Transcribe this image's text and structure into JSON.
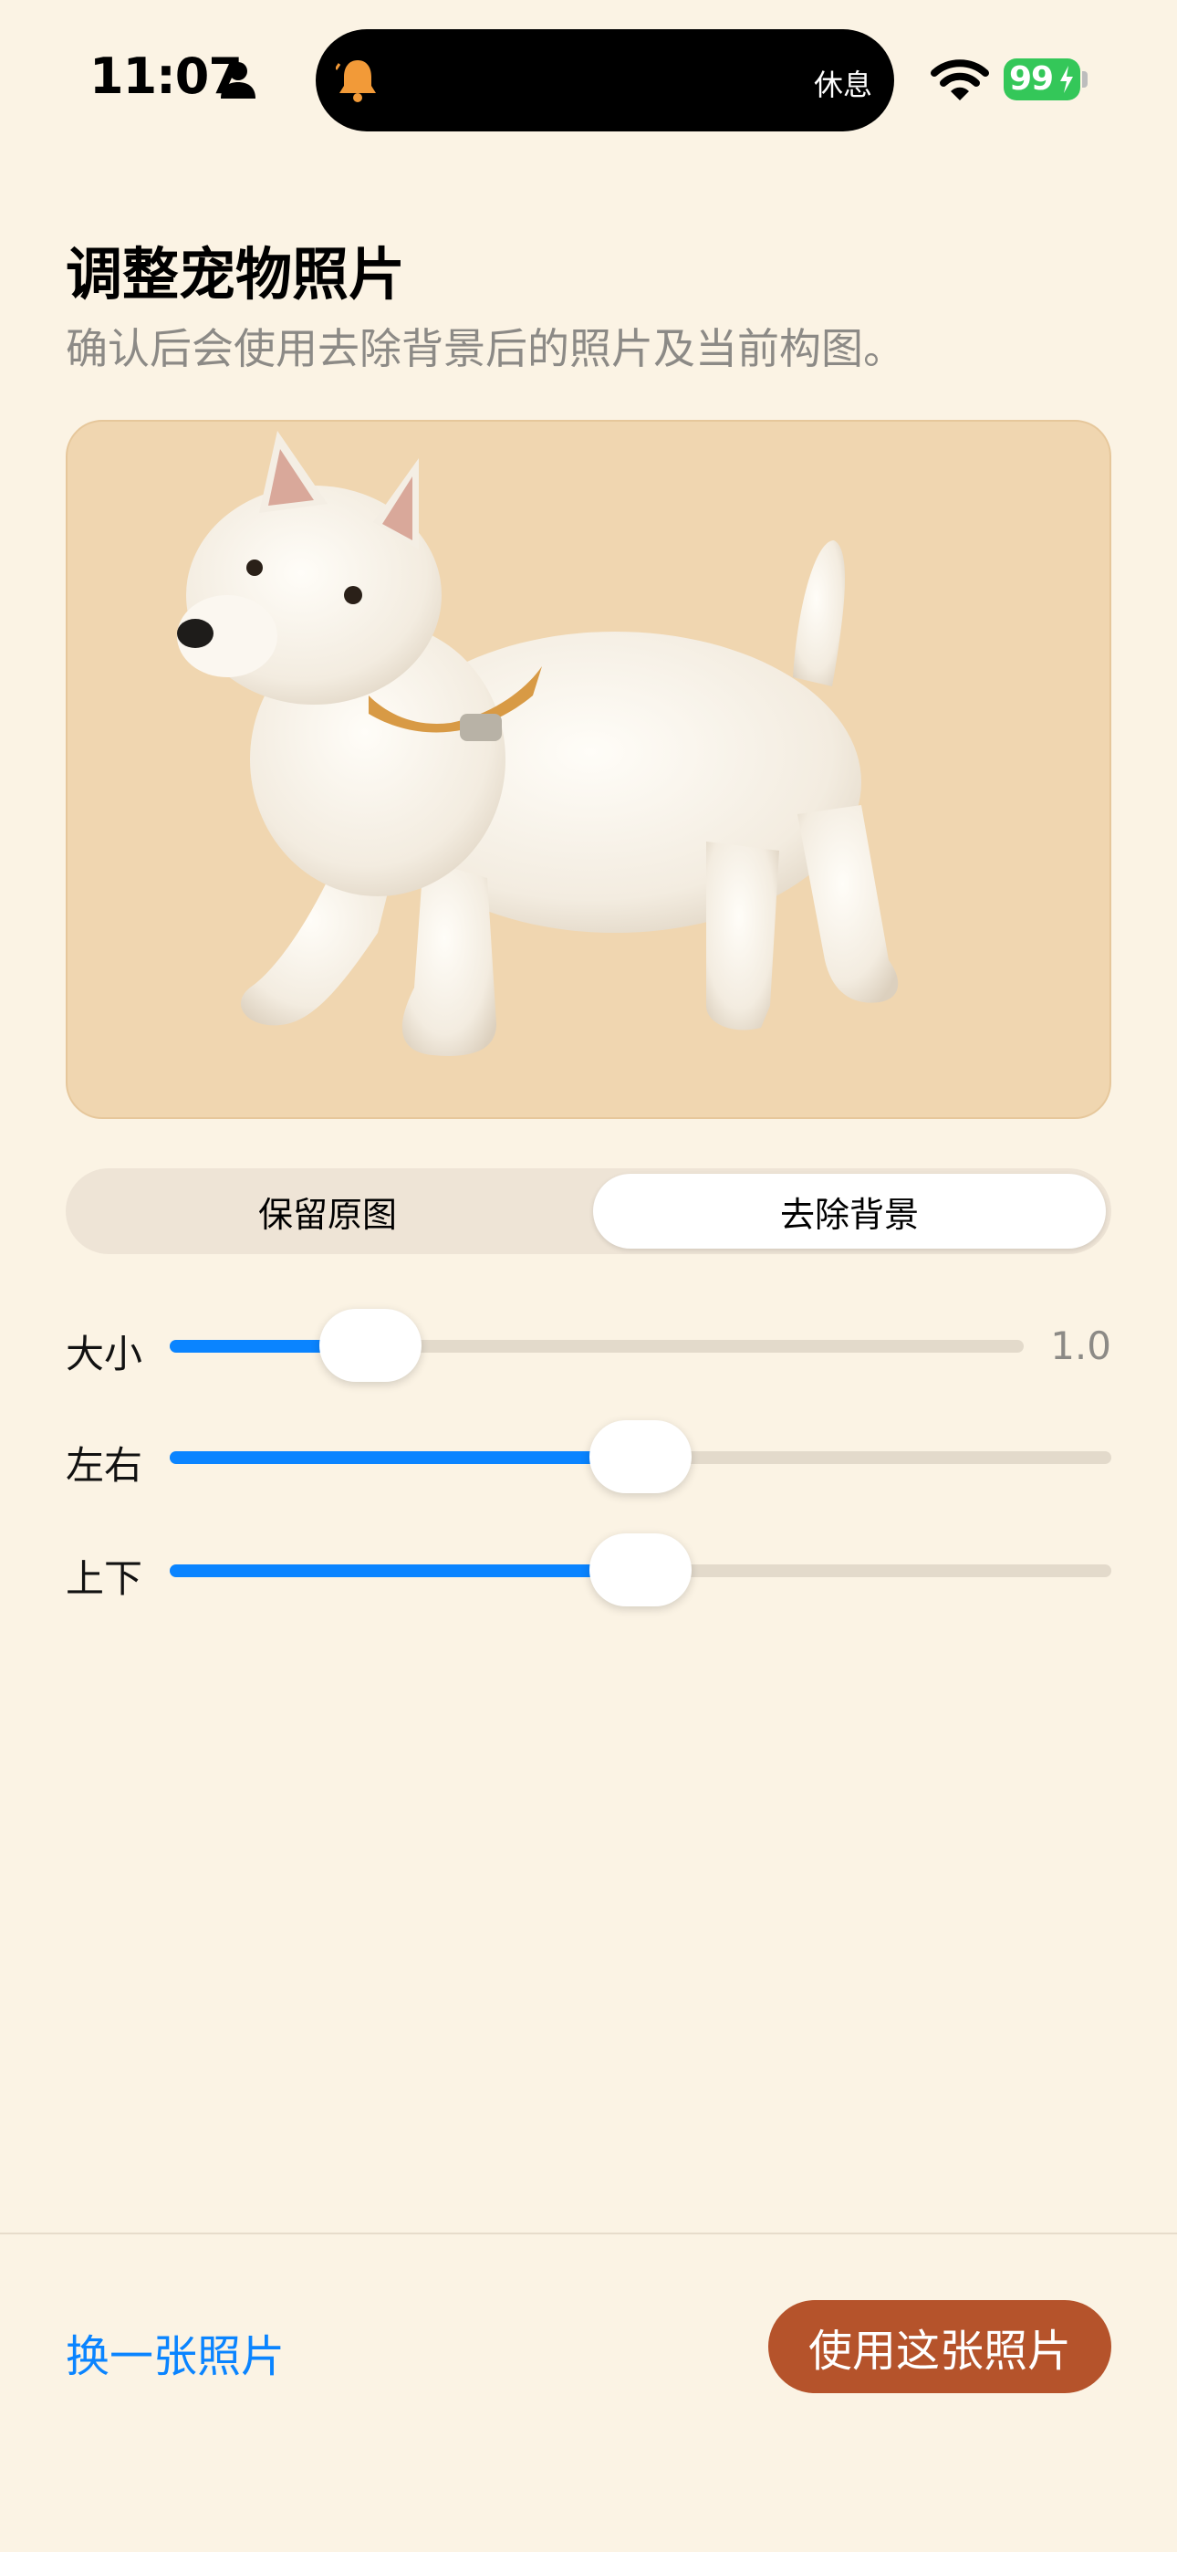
{
  "status_bar": {
    "time": "11:07",
    "focus_mode": "休息",
    "battery_percent": "99"
  },
  "header": {
    "title": "调整宠物照片",
    "subtitle": "确认后会使用去除背景后的照片及当前构图。"
  },
  "segmented_control": {
    "options": [
      "保留原图",
      "去除背景"
    ],
    "selected": "去除背景"
  },
  "sliders": [
    {
      "label": "大小",
      "value_text": "1.0",
      "fraction": 0.235
    },
    {
      "label": "左右",
      "value_text": "",
      "fraction": 0.5
    },
    {
      "label": "上下",
      "value_text": "",
      "fraction": 0.5
    }
  ],
  "footer": {
    "replace_label": "换一张照片",
    "confirm_label": "使用这张照片"
  },
  "colors": {
    "background": "#FBF3E4",
    "accent": "#0A84FF",
    "primary_button": "#B5532B",
    "photo_background": "#F0D6B0"
  },
  "icons": [
    "person-icon",
    "bell-icon",
    "wifi-icon",
    "battery-icon",
    "bolt-icon"
  ]
}
